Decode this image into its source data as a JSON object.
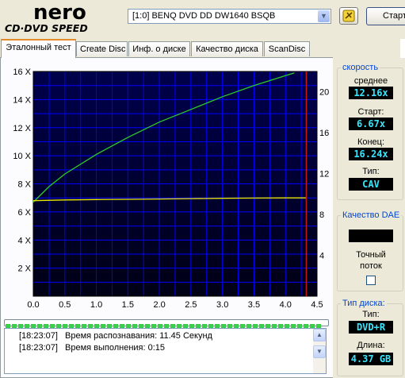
{
  "header": {
    "logo_top": "nero",
    "logo_bottom": "CD·DVD SPEED",
    "drive": "[1:0]  BENQ DVD DD DW1640 BSQB",
    "start_label": "Старт"
  },
  "tabs": [
    {
      "label": "Эталонный тест",
      "active": true
    },
    {
      "label": "Create Disc",
      "active": false
    },
    {
      "label": "Инф. о диске",
      "active": false
    },
    {
      "label": "Качество диска",
      "active": false
    },
    {
      "label": "ScanDisc",
      "active": false
    }
  ],
  "chart_data": {
    "type": "line",
    "background": "#000033",
    "grid_color": "#0000ff",
    "x_ticks": [
      "0.0",
      "0.5",
      "1.0",
      "1.5",
      "2.0",
      "2.5",
      "3.0",
      "3.5",
      "4.0",
      "4.5"
    ],
    "xlim": [
      0,
      4.5
    ],
    "y_left_ticks": [
      "2 X",
      "4 X",
      "6 X",
      "8 X",
      "10 X",
      "12 X",
      "14 X",
      "16 X"
    ],
    "y_left_lim": [
      0,
      16
    ],
    "y_right_ticks": [
      "4",
      "8",
      "12",
      "16",
      "20"
    ],
    "y_right_lim": [
      0,
      22
    ],
    "marker_x": 4.33,
    "series": [
      {
        "color": "#2ccc2c",
        "x": [
          0,
          0.25,
          0.5,
          1.0,
          1.5,
          2.0,
          2.5,
          3.0,
          3.5,
          4.0,
          4.14
        ],
        "y": [
          6.7,
          7.8,
          8.7,
          10.1,
          11.3,
          12.4,
          13.3,
          14.2,
          15.0,
          15.7,
          15.9
        ]
      },
      {
        "color": "#e8e800",
        "x": [
          0,
          0.5,
          1.0,
          1.5,
          2.0,
          2.5,
          3.0,
          3.5,
          4.0,
          4.33
        ],
        "y": [
          6.8,
          6.85,
          6.88,
          6.9,
          6.92,
          6.95,
          6.97,
          6.99,
          7.0,
          7.0
        ]
      }
    ]
  },
  "progress_percent": 100,
  "log": [
    {
      "time": "[18:23:07]",
      "text": "Время распознавания: 11.45 Секунд"
    },
    {
      "time": "[18:23:07]",
      "text": "Время выполнения:  0:15"
    }
  ],
  "speed": {
    "title": "скорость",
    "avg_label": "среднее",
    "avg": "12.16x",
    "start_label": "Старт:",
    "start": "6.67x",
    "end_label": "Конец:",
    "end": "16.24x",
    "type_label": "Тип:",
    "type": "CAV"
  },
  "dae": {
    "title": "Качество DAE",
    "accurate_label_1": "Точный",
    "accurate_label_2": "поток"
  },
  "disc": {
    "title": "Тип диска:",
    "type_label": "Тип:",
    "type": "DVD+R",
    "length_label": "Длина:",
    "length": "4.37 GB"
  }
}
